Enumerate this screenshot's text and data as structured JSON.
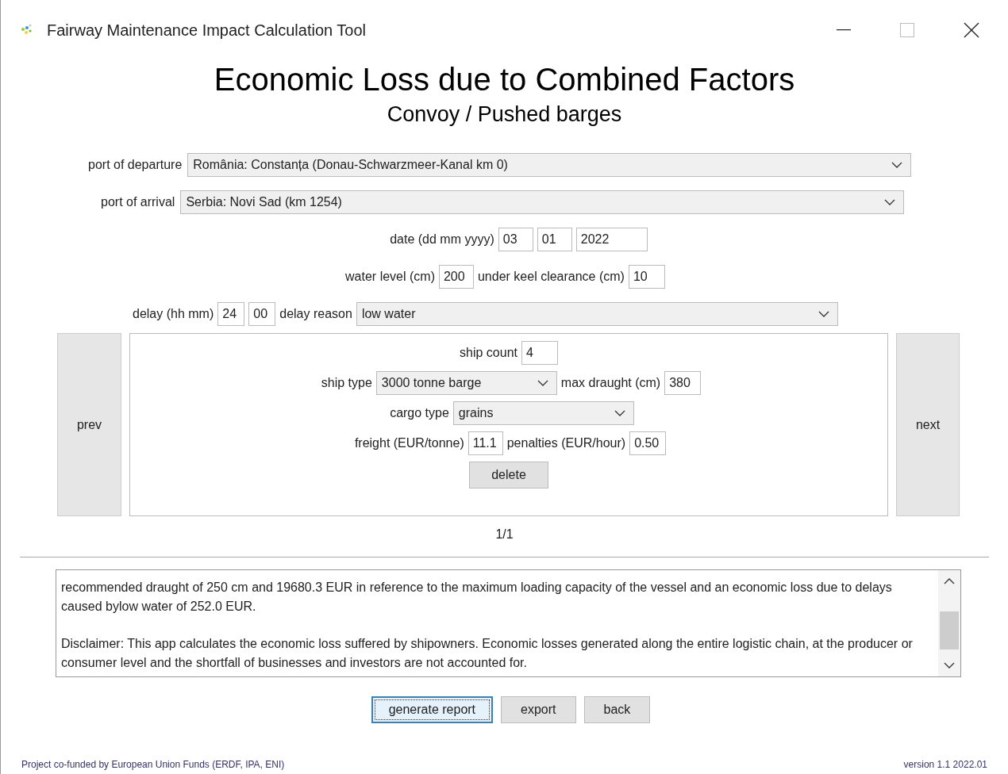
{
  "window": {
    "title": "Fairway Maintenance Impact Calculation Tool"
  },
  "heading": "Economic Loss due to Combined Factors",
  "subheading": "Convoy / Pushed barges",
  "departure": {
    "label": "port of departure",
    "value": "România: Constanța (Donau-Schwarzmeer-Kanal km 0)"
  },
  "arrival": {
    "label": "port of arrival",
    "value": "Serbia: Novi Sad (km 1254)"
  },
  "date": {
    "label": "date (dd mm yyyy)",
    "day": "03",
    "month": "01",
    "year": "2022"
  },
  "water": {
    "label": "water level (cm)",
    "value": "200",
    "keel_label": "under keel clearance (cm)",
    "keel": "10"
  },
  "delay": {
    "label": "delay (hh mm)",
    "hours": "24",
    "minutes": "00",
    "reason_label": "delay reason",
    "reason": "low water"
  },
  "ship": {
    "count_label": "ship count",
    "count": "4",
    "type_label": "ship type",
    "type": "3000 tonne barge",
    "draught_label": "max draught (cm)",
    "draught": "380",
    "cargo_label": "cargo type",
    "cargo": "grains",
    "freight_label": "freight (EUR/tonne)",
    "freight": "11.1",
    "penalties_label": "penalties (EUR/hour)",
    "penalties": "0.50",
    "delete": "delete"
  },
  "pager": {
    "prev": "prev",
    "next": "next",
    "page": "1/1"
  },
  "report": [
    "recommended draught of 250 cm and 19680.3 EUR in reference to the maximum loading capacity of the vessel and an economic loss due to delays caused bylow water of 252.0 EUR.",
    "Disclaimer: This app calculates the economic loss suffered by shipowners. Economic losses generated along the entire logistic chain, at the producer or consumer level and the shortfall of businesses and investors are not accounted for."
  ],
  "buttons": [
    {
      "label": "generate report",
      "focused": true
    },
    {
      "label": "export",
      "focused": false
    },
    {
      "label": "back",
      "focused": false
    }
  ],
  "footer": {
    "left": "Project co-funded by European Union Funds (ERDF, IPA, ENI)",
    "right": "version 1.1 2022.01"
  }
}
